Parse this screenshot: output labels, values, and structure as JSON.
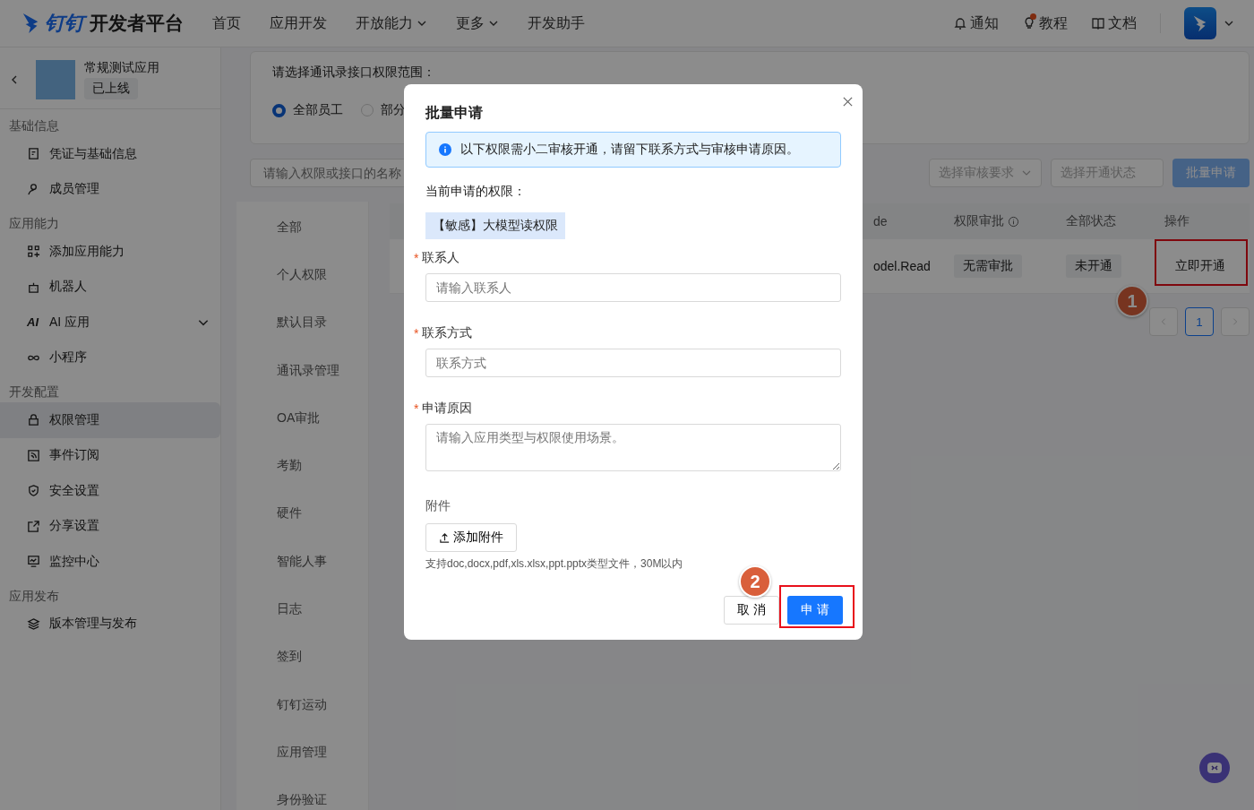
{
  "header": {
    "brand_mark": "钉钉",
    "brand_name": "开发者平台",
    "nav": [
      {
        "label": "首页",
        "dropdown": false
      },
      {
        "label": "应用开发",
        "dropdown": false
      },
      {
        "label": "开放能力",
        "dropdown": true
      },
      {
        "label": "更多",
        "dropdown": true
      },
      {
        "label": "开发助手",
        "dropdown": false
      }
    ],
    "tools": [
      {
        "label": "通知",
        "dot": false
      },
      {
        "label": "教程",
        "dot": true
      },
      {
        "label": "文档",
        "dot": false
      }
    ]
  },
  "sidebar": {
    "app": {
      "name": "常规测试应用",
      "status": "已上线"
    },
    "groups": [
      {
        "title": "基础信息",
        "items": [
          {
            "label": "凭证与基础信息",
            "kind": "link",
            "selected": false
          },
          {
            "label": "成员管理",
            "kind": "link",
            "selected": false
          }
        ]
      },
      {
        "title": "应用能力",
        "items": [
          {
            "label": "添加应用能力",
            "kind": "link",
            "selected": false
          },
          {
            "label": "机器人",
            "kind": "link",
            "selected": false
          },
          {
            "label": "AI 应用",
            "kind": "group",
            "icon_text": "AI",
            "expanded": false,
            "selected": false
          },
          {
            "label": "小程序",
            "kind": "link",
            "selected": false
          }
        ]
      },
      {
        "title": "开发配置",
        "items": [
          {
            "label": "权限管理",
            "kind": "link",
            "selected": true
          },
          {
            "label": "事件订阅",
            "kind": "link",
            "selected": false
          },
          {
            "label": "安全设置",
            "kind": "link",
            "selected": false
          },
          {
            "label": "分享设置",
            "kind": "link",
            "selected": false
          },
          {
            "label": "监控中心",
            "kind": "link",
            "selected": false
          }
        ]
      },
      {
        "title": "应用发布",
        "items": [
          {
            "label": "版本管理与发布",
            "kind": "link",
            "selected": false
          }
        ]
      }
    ]
  },
  "scope": {
    "title": "请选择通讯录接口权限范围：",
    "options": [
      {
        "label": "全部员工",
        "selected": true
      },
      {
        "label": "部分",
        "selected": false
      }
    ]
  },
  "filters": {
    "search_placeholder": "请输入权限或接口的名称",
    "selects": [
      {
        "placeholder": "选择审核要求",
        "caret": true
      },
      {
        "placeholder": "选择开通状态",
        "caret": false
      }
    ],
    "batch_button": {
      "label": "批量申请",
      "disabled": true
    }
  },
  "categories": [
    {
      "label": "全部",
      "selected": false
    },
    {
      "label": "个人权限",
      "selected": false
    },
    {
      "label": "默认目录",
      "selected": false
    },
    {
      "label": "通讯录管理",
      "selected": false
    },
    {
      "label": "OA审批",
      "selected": false
    },
    {
      "label": "考勤",
      "selected": false
    },
    {
      "label": "硬件",
      "selected": false
    },
    {
      "label": "智能人事",
      "selected": false
    },
    {
      "label": "日志",
      "selected": false
    },
    {
      "label": "签到",
      "selected": false
    },
    {
      "label": "钉钉运动",
      "selected": false
    },
    {
      "label": "应用管理",
      "selected": false
    },
    {
      "label": "身份验证",
      "selected": false
    }
  ],
  "table": {
    "columns": [
      {
        "label": "de",
        "info": false
      },
      {
        "label": "权限审批",
        "info": true
      },
      {
        "label": "全部状态",
        "info": false
      },
      {
        "label": "操作",
        "info": false
      }
    ],
    "rows": [
      {
        "cells": [
          {
            "text": "odel.Read",
            "kind": "text"
          },
          {
            "text": "无需审批",
            "kind": "tag"
          },
          {
            "text": "未开通",
            "kind": "tag"
          },
          {
            "text": "立即开通",
            "kind": "link",
            "highlighted": true,
            "step": "1"
          }
        ]
      }
    ]
  },
  "pagination": {
    "pages": [
      {
        "label": "1",
        "selected": true
      }
    ]
  },
  "modal": {
    "title": "批量申请",
    "alert": "以下权限需小二审核开通，请留下联系方式与审核申请原因。",
    "current_label": "当前申请的权限：",
    "permissions": [
      "【敏感】大模型读权限"
    ],
    "fields": [
      {
        "label": "联系人",
        "required_mark": "*",
        "kind": "input",
        "placeholder": "请输入联系人"
      },
      {
        "label": "联系方式",
        "required_mark": "*",
        "kind": "input",
        "placeholder": "联系方式"
      },
      {
        "label": "申请原因",
        "required_mark": "*",
        "kind": "textarea",
        "placeholder": "请输入应用类型与权限使用场景。"
      }
    ],
    "attachment": {
      "label": "附件",
      "button": "添加附件",
      "hint": "支持doc,docx,pdf,xls.xlsx,ppt.pptx类型文件，30M以内"
    },
    "cancel": {
      "label": "取 消"
    },
    "submit": {
      "label": "申 请",
      "highlighted": true,
      "step": "2"
    }
  }
}
